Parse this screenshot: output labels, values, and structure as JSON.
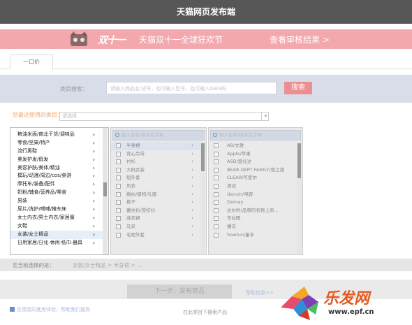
{
  "window": {
    "title": "天猫网页发布端"
  },
  "banner": {
    "logo_text": "双十一",
    "slogan": "天猫双十一全球狂欢节",
    "link": "查看审核结果 >"
  },
  "tabs": [
    {
      "label": "一口价"
    }
  ],
  "search": {
    "label": "类目搜索：",
    "placeholder": "请输入商品名/货号，也可输入型号，也可输入ISBN码",
    "button": "搜索"
  },
  "recent": {
    "label": "您最近使用的类目：",
    "placeholder": "请选择"
  },
  "columns": {
    "level1": [
      "粮油米面/南北干货/调味品",
      "零食/坚果/特产",
      "流行男鞋",
      "美发护发/假发",
      "美容护肤/美体/精油",
      "模玩/动漫/周边/cos/桌游",
      "摩托车/装备/配件",
      "奶粉/辅食/营养品/零食",
      "男装",
      "尿片/洗护/喂哺/推车床",
      "女士内衣/男士内衣/家居服",
      "女鞋",
      "女装/女士精品",
      "日用家居/日化·休闲·纸巾·器具"
    ],
    "level1_selected": 12,
    "level2_search": "输入名称/拼音首字母",
    "level2": [
      "半身裙",
      "背心吊带",
      "衬衫",
      "大码女装",
      "短外套",
      "风衣",
      "婚纱/旗袍/礼服",
      "裤子",
      "蕾丝衫/雪纺衫",
      "连衣裙",
      "马夹",
      "毛呢外套"
    ],
    "level2_highlight": 0,
    "level3_search": "输入名称/拼音首字母",
    "level3": [
      "AB/文雅",
      "Apple/苹果",
      "ASD/爱仕达",
      "BEAR DEPT FAMILY/熊之旅",
      "CLEAR/可爱尔",
      "测试",
      "danvin/电容",
      "Demay",
      "达尔利/品牌的名称上测...",
      "东拉图",
      "播花",
      "howfun/童丰"
    ]
  },
  "path": {
    "label": "您当前选择的是：",
    "value": "女装/女士精品 > 半身裙 > ..."
  },
  "actions": {
    "next_button": "下一步，发布商品",
    "help_link": "帮助信息>>",
    "feedback_link": "反馈您的使用体验，帮助我们提高",
    "bottom_link": "在此类目下搜索产品"
  },
  "watermark": {
    "text": "乐发网",
    "url": "www.epf.cn"
  },
  "colors": {
    "titlebar": "#575757",
    "banner": "#f3a8ad",
    "search_band": "#d9ddea",
    "accent": "#ec8f91",
    "link": "#a8bbe0"
  }
}
